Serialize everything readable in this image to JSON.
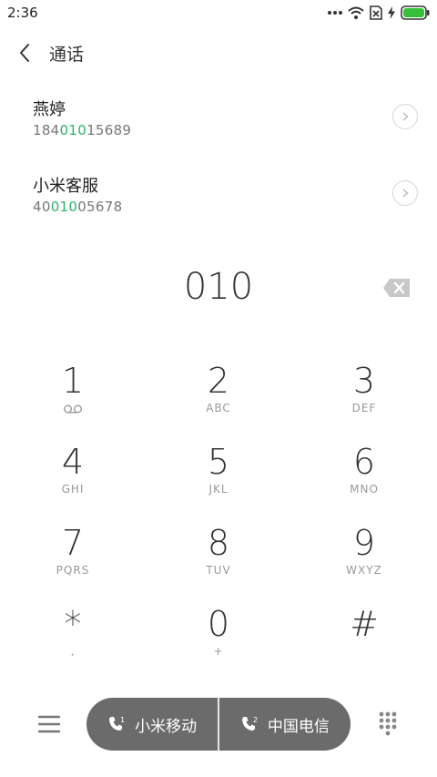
{
  "status_bar": {
    "time": "2:36",
    "icons": [
      "more-dots-icon",
      "wifi-icon",
      "no-sim-icon",
      "charging-icon",
      "battery-icon"
    ],
    "battery_color": "#35c23a"
  },
  "header": {
    "title": "通话"
  },
  "results": [
    {
      "name": "燕婷",
      "number_pre": "184",
      "number_match": "010",
      "number_post": "15689"
    },
    {
      "name": "小米客服",
      "number_pre": "40",
      "number_match": "010",
      "number_post": "05678"
    }
  ],
  "highlight_color": "#2bb36b",
  "dialed_number": "010",
  "keypad": [
    {
      "digit": "1",
      "letters": "",
      "icon": "voicemail-icon"
    },
    {
      "digit": "2",
      "letters": "ABC"
    },
    {
      "digit": "3",
      "letters": "DEF"
    },
    {
      "digit": "4",
      "letters": "GHI"
    },
    {
      "digit": "5",
      "letters": "JKL"
    },
    {
      "digit": "6",
      "letters": "MNO"
    },
    {
      "digit": "7",
      "letters": "PQRS"
    },
    {
      "digit": "8",
      "letters": "TUV"
    },
    {
      "digit": "9",
      "letters": "WXYZ"
    },
    {
      "digit": "*",
      "letters": ","
    },
    {
      "digit": "0",
      "letters": "+"
    },
    {
      "digit": "#",
      "letters": ""
    }
  ],
  "bottom_bar": {
    "sim1_label": "小米移动",
    "sim2_label": "中国电信",
    "sim1_badge": "1",
    "sim2_badge": "2"
  }
}
